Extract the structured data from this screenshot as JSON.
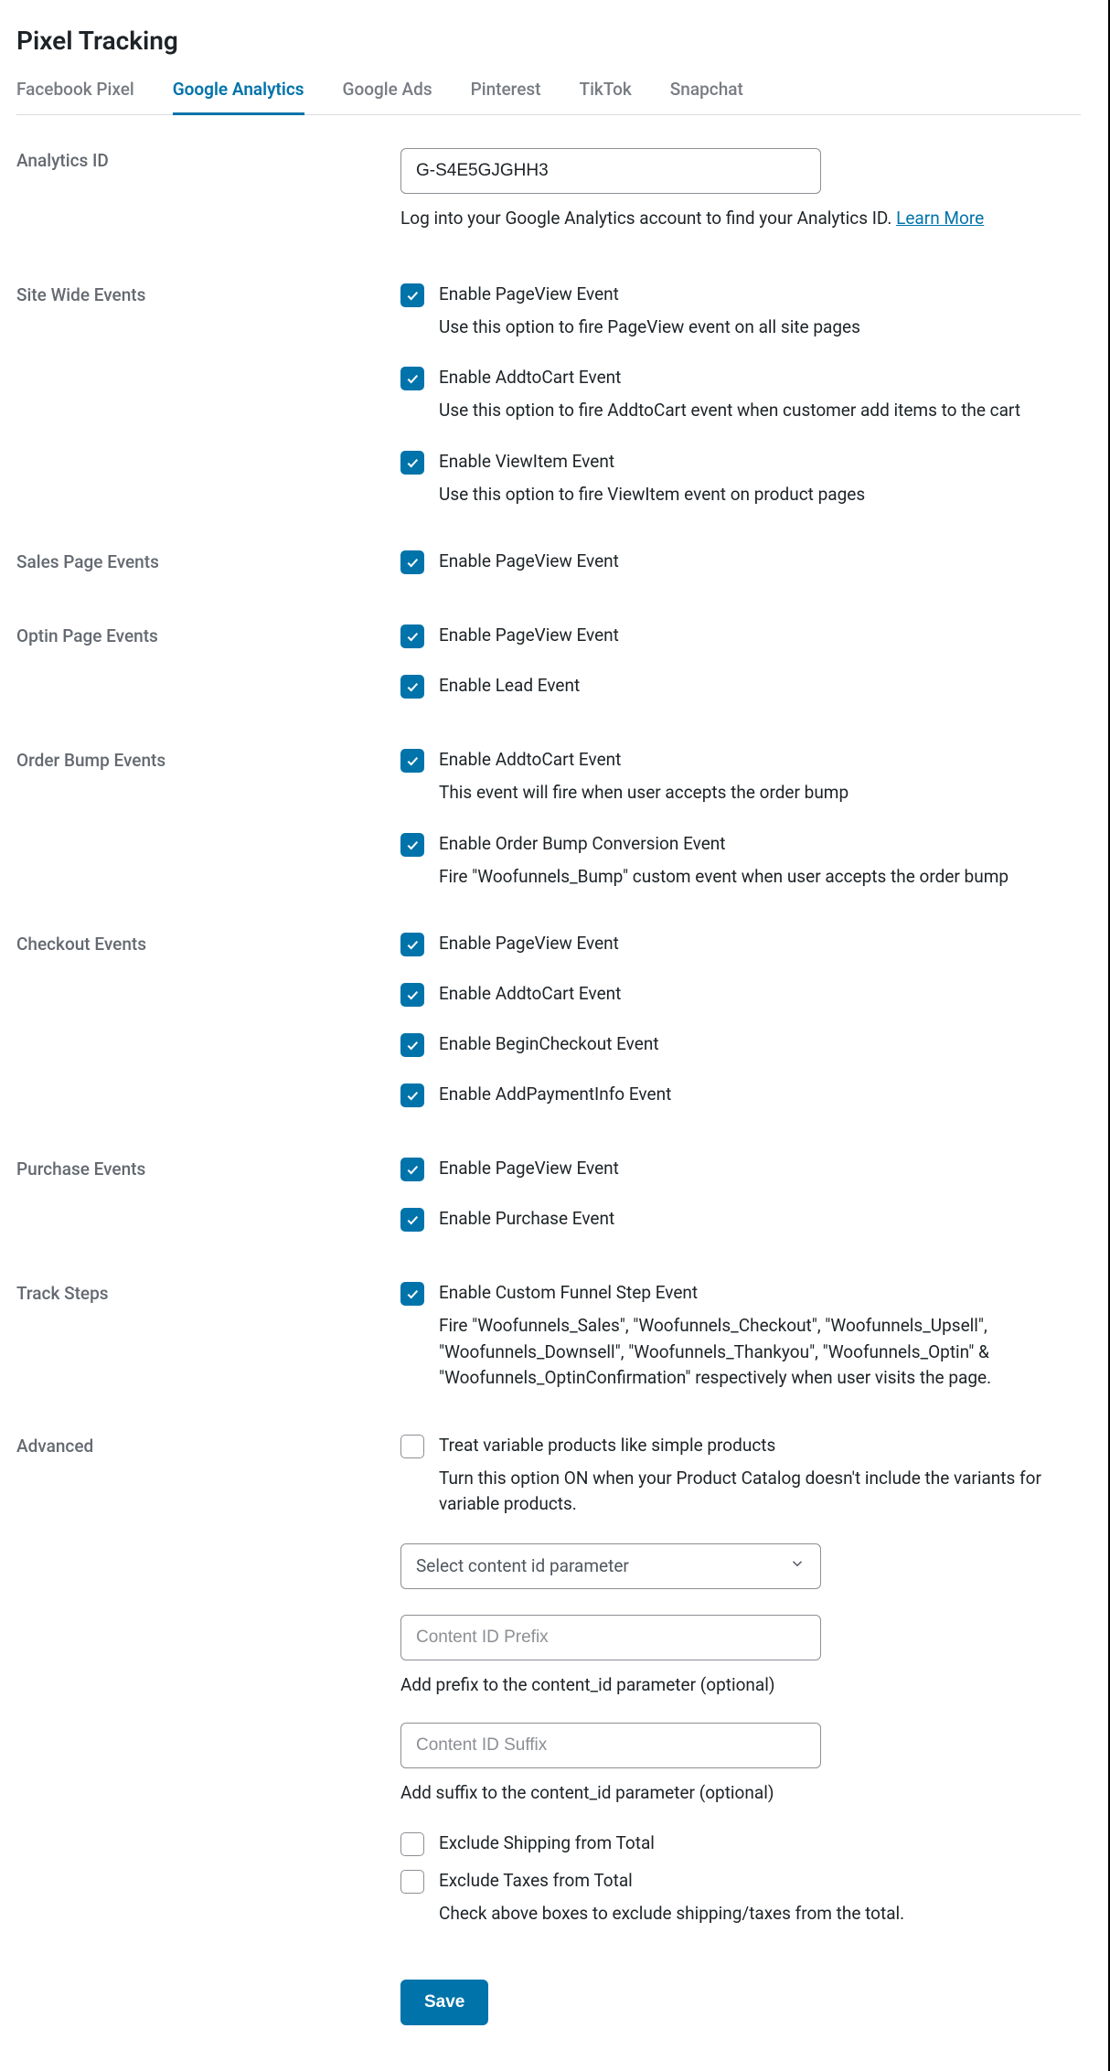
{
  "title": "Pixel Tracking",
  "tabs": [
    {
      "label": "Facebook Pixel",
      "active": false
    },
    {
      "label": "Google Analytics",
      "active": true
    },
    {
      "label": "Google Ads",
      "active": false
    },
    {
      "label": "Pinterest",
      "active": false
    },
    {
      "label": "TikTok",
      "active": false
    },
    {
      "label": "Snapchat",
      "active": false
    }
  ],
  "analytics_id": {
    "label": "Analytics ID",
    "value": "G-S4E5GJGHH3",
    "help": "Log into your Google Analytics account to find your Analytics ID. ",
    "learn_more": "Learn More"
  },
  "sections": {
    "sitewide": {
      "label": "Site Wide Events",
      "items": [
        {
          "checked": true,
          "label": "Enable PageView Event",
          "desc": "Use this option to fire PageView event on all site pages"
        },
        {
          "checked": true,
          "label": "Enable AddtoCart Event",
          "desc": "Use this option to fire AddtoCart event when customer add items to the cart"
        },
        {
          "checked": true,
          "label": "Enable ViewItem Event",
          "desc": "Use this option to fire ViewItem event on product pages"
        }
      ]
    },
    "sales": {
      "label": "Sales Page Events",
      "items": [
        {
          "checked": true,
          "label": "Enable PageView Event"
        }
      ]
    },
    "optin": {
      "label": "Optin Page Events",
      "items": [
        {
          "checked": true,
          "label": "Enable PageView Event"
        },
        {
          "checked": true,
          "label": "Enable Lead Event"
        }
      ]
    },
    "orderbump": {
      "label": "Order Bump Events",
      "items": [
        {
          "checked": true,
          "label": "Enable AddtoCart Event",
          "desc": "This event will fire when user accepts the order bump"
        },
        {
          "checked": true,
          "label": "Enable Order Bump Conversion Event",
          "desc": "Fire \"Woofunnels_Bump\" custom event when user accepts the order bump"
        }
      ]
    },
    "checkout": {
      "label": "Checkout Events",
      "items": [
        {
          "checked": true,
          "label": "Enable PageView Event"
        },
        {
          "checked": true,
          "label": "Enable AddtoCart Event"
        },
        {
          "checked": true,
          "label": "Enable BeginCheckout Event"
        },
        {
          "checked": true,
          "label": "Enable AddPaymentInfo Event"
        }
      ]
    },
    "purchase": {
      "label": "Purchase Events",
      "items": [
        {
          "checked": true,
          "label": "Enable PageView Event"
        },
        {
          "checked": true,
          "label": "Enable Purchase Event"
        }
      ]
    },
    "tracksteps": {
      "label": "Track Steps",
      "items": [
        {
          "checked": true,
          "label": "Enable Custom Funnel Step Event",
          "desc": "Fire \"Woofunnels_Sales\", \"Woofunnels_Checkout\", \"Woofunnels_Upsell\", \"Woofunnels_Downsell\", \"Woofunnels_Thankyou\", \"Woofunnels_Optin\" & \"Woofunnels_OptinConfirmation\" respectively when user visits the page."
        }
      ]
    }
  },
  "advanced": {
    "label": "Advanced",
    "variable_products": {
      "checked": false,
      "label": "Treat variable products like simple products",
      "desc": "Turn this option ON when your Product Catalog doesn't include the variants for variable products."
    },
    "content_id_select": {
      "value": "Select content id parameter"
    },
    "content_id_prefix": {
      "placeholder": "Content ID Prefix",
      "help": "Add prefix to the content_id parameter (optional)"
    },
    "content_id_suffix": {
      "placeholder": "Content ID Suffix",
      "help": "Add suffix to the content_id parameter (optional)"
    },
    "exclude_shipping": {
      "checked": false,
      "label": "Exclude Shipping from Total"
    },
    "exclude_taxes": {
      "checked": false,
      "label": "Exclude Taxes from Total",
      "desc": "Check above boxes to exclude shipping/taxes from the total."
    }
  },
  "save_label": "Save"
}
